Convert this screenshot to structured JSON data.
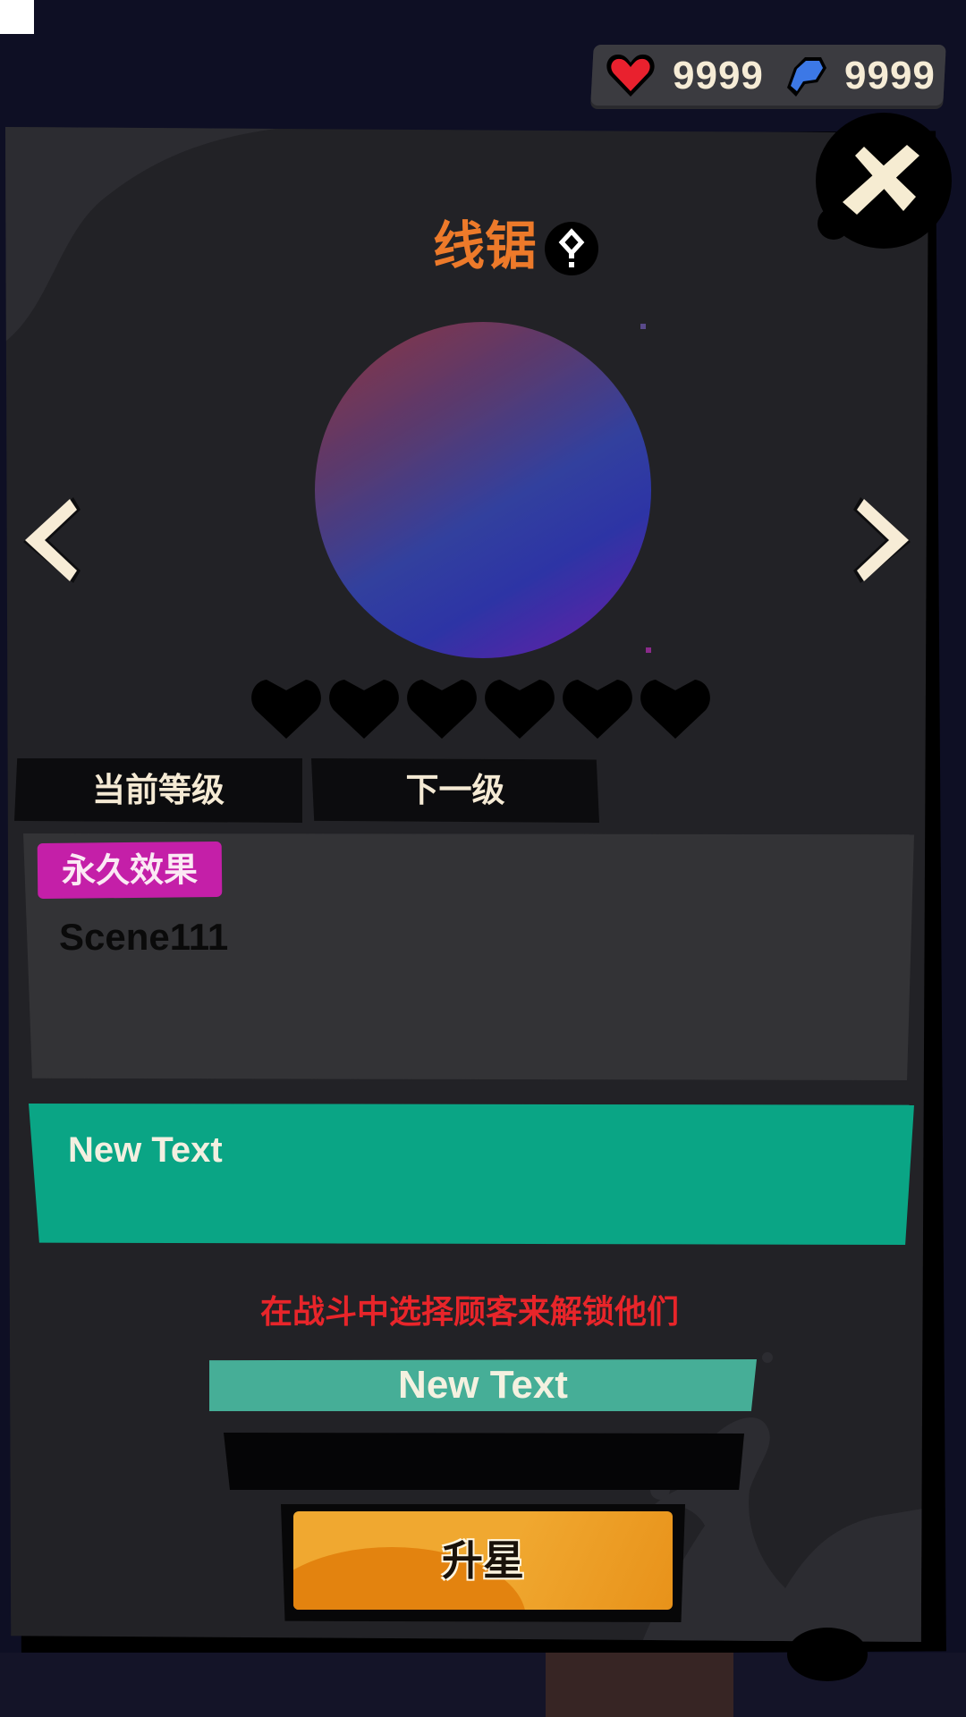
{
  "currency": {
    "hearts": "9999",
    "hearts_icon": "heart-icon",
    "gems": "9999",
    "gems_icon": "blue-gem-icon"
  },
  "panel": {
    "title": "线锯",
    "help_icon": "question-icon",
    "close_icon": "close-x-icon",
    "prev_icon": "chevron-left-icon",
    "next_icon": "chevron-right-icon",
    "star_rating": {
      "filled": 0,
      "total": 6
    },
    "tabs": [
      {
        "label": "当前等级"
      },
      {
        "label": "下一级"
      }
    ],
    "effect": {
      "badge": "永久效果",
      "text": "Scene111"
    },
    "green_box_text": "New Text",
    "unlock_hint": "在战斗中选择顾客来解锁他们",
    "teal_bar_text": "New Text",
    "upgrade_button": "升星"
  },
  "colors": {
    "title": "#ed7a2a",
    "badge": "#c41fa8",
    "green_box": "#0aa585",
    "hint": "#e8252a",
    "upgrade": "#f0a830"
  }
}
